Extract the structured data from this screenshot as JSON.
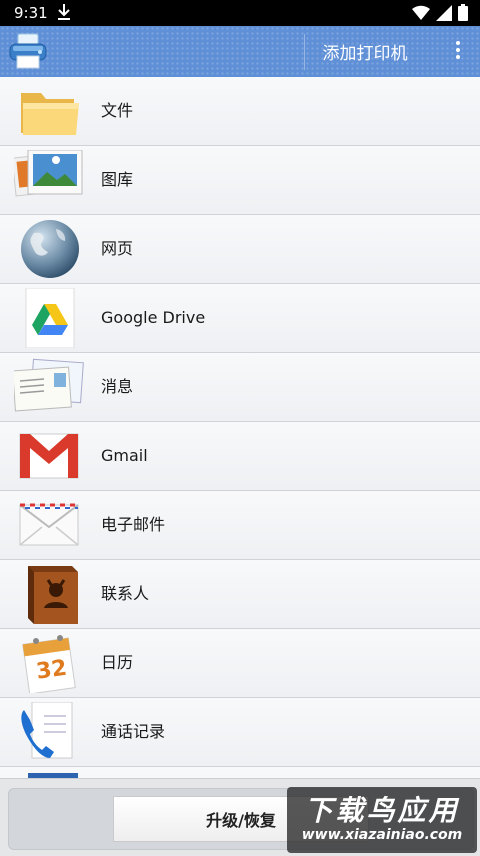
{
  "status_bar": {
    "time": "9:31"
  },
  "app_bar": {
    "add_printer_label": "添加打印机"
  },
  "list": {
    "items": [
      {
        "label": "文件",
        "icon": "folder-icon"
      },
      {
        "label": "图库",
        "icon": "gallery-icon"
      },
      {
        "label": "网页",
        "icon": "globe-icon"
      },
      {
        "label": "Google Drive",
        "icon": "google-drive-icon"
      },
      {
        "label": "消息",
        "icon": "postcard-icon"
      },
      {
        "label": "Gmail",
        "icon": "gmail-icon"
      },
      {
        "label": "电子邮件",
        "icon": "envelope-icon"
      },
      {
        "label": "联系人",
        "icon": "contacts-book-icon"
      },
      {
        "label": "日历",
        "icon": "calendar-icon"
      },
      {
        "label": "通话记录",
        "icon": "phone-icon"
      }
    ],
    "calendar_day": "32"
  },
  "bottom": {
    "upgrade_label": "升级/恢复"
  },
  "watermark": {
    "main": "下载鸟应用",
    "sub": "www.xiazainiao.com"
  }
}
